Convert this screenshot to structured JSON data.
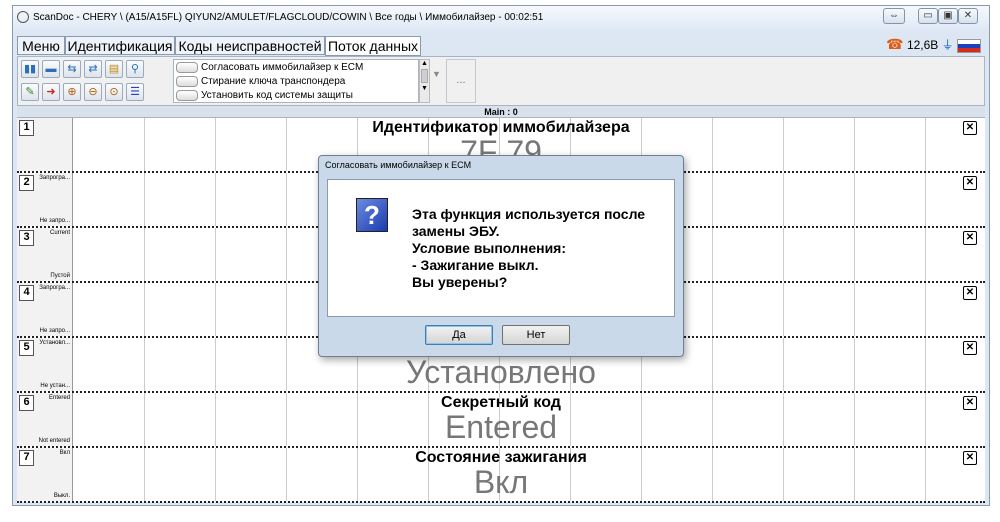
{
  "window": {
    "title": "ScanDoc - CHERY \\ (A15/A15FL) QIYUN2/AMULET/FLAGCLOUD/COWIN \\ Все годы \\ Иммобилайзер - 00:02:51",
    "restore_glyph": "⇔",
    "min_glyph": "▭",
    "max_glyph": "▣",
    "close_glyph": "✕"
  },
  "tabs": [
    {
      "label": "Меню"
    },
    {
      "label": "Идентификация"
    },
    {
      "label": "Коды неисправностей"
    },
    {
      "label": "Поток данных"
    }
  ],
  "status": {
    "phone_glyph": "☎",
    "voltage": "12,6В",
    "plug_glyph": "⏚"
  },
  "toolbar": {
    "icons_row1": [
      "▮▮",
      "▬",
      "⇆",
      "⇄",
      "▤",
      "⚲"
    ],
    "icons_row2": [
      "✎",
      "➜",
      "⊕",
      "⊖",
      "⊙",
      "☰"
    ],
    "commands": [
      {
        "label": "Согласовать иммобилайзер к ECM"
      },
      {
        "label": "Стирание ключа транспондера"
      },
      {
        "label": "Установить код системы защиты"
      }
    ],
    "more_label": "..."
  },
  "main_label": "Main : 0",
  "rows": [
    {
      "num": "1",
      "top": "",
      "bottom": "",
      "title": "Идентификатор иммобилайзера",
      "value": "7F 79"
    },
    {
      "num": "2",
      "top": "Запрогра...",
      "bottom": "Не запро...",
      "title": "",
      "value": ""
    },
    {
      "num": "3",
      "top": "Current",
      "bottom": "Пустой",
      "title": "",
      "value": ""
    },
    {
      "num": "4",
      "top": "Запрогра...",
      "bottom": "Не запро...",
      "title": "",
      "value": ""
    },
    {
      "num": "5",
      "top": "Установл...",
      "bottom": "Не устан...",
      "title": "",
      "value": "Установлено"
    },
    {
      "num": "6",
      "top": "Entered",
      "bottom": "Not entered",
      "title": "Секретный код",
      "value": "Entered"
    },
    {
      "num": "7",
      "top": "Вкл",
      "bottom": "Выкл.",
      "title": "Состояние зажигания",
      "value": "Вкл"
    }
  ],
  "row_close_glyph": "✕",
  "dialog": {
    "title": "Согласовать иммобилайзер к ECM",
    "icon_glyph": "?",
    "message": "Эта функция используется после\nзамены ЭБУ.\nУсловие выполнения:\n- Зажигание выкл.\nВы уверены?",
    "yes": "Да",
    "no": "Нет"
  }
}
